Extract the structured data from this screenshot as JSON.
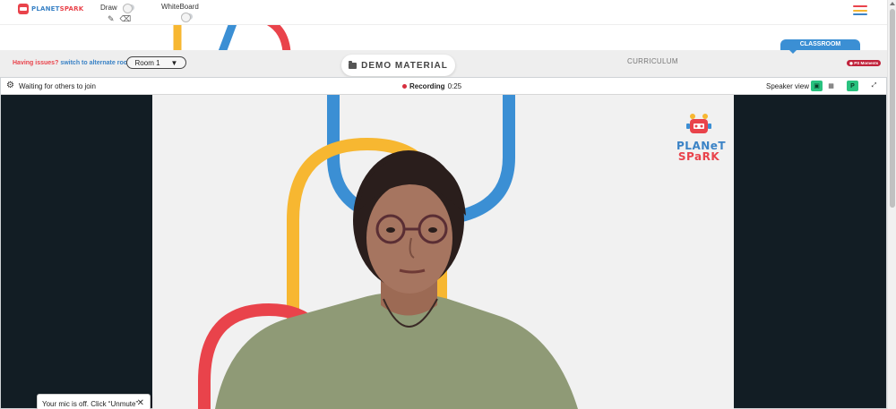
{
  "app": {
    "logo_text_part1": "PLANET",
    "logo_text_part2": "SPARK",
    "colors": {
      "red": "#e9434b",
      "blue": "#3b83c6",
      "yellow": "#f7b731",
      "green": "#29c27f"
    }
  },
  "toolbar": {
    "draw_label": "Draw",
    "whiteboard_label": "WhiteBoard",
    "draw_on": false,
    "whiteboard_on": false,
    "pencil_icon": "pencil-icon",
    "eraser_icon": "eraser-icon",
    "menu_icon": "hamburger-menu-icon"
  },
  "strip": {
    "issues_label": "Having issues?",
    "switch_link": "switch to alternate room",
    "room_value": "Room 1",
    "room_arrow": "▼",
    "demo_material": "DEMO MATERIAL",
    "curriculum": "CURRICULUM",
    "classroom": "CLASSROOM",
    "ps_moments": "PS Moments"
  },
  "panel": {
    "waiting_text": "Waiting for others to join",
    "recording_label": "Recording",
    "recording_time": "0:25",
    "speaker_view": "Speaker view",
    "participant_initial": "P",
    "settings_icon": "gear-icon",
    "expand_icon": "expand-icon"
  },
  "stage_logo": {
    "line1": "PLANeT",
    "line2": "SPaRK"
  },
  "toast": {
    "text": "Your mic is off. Click “Unmute”",
    "close": "✕"
  }
}
